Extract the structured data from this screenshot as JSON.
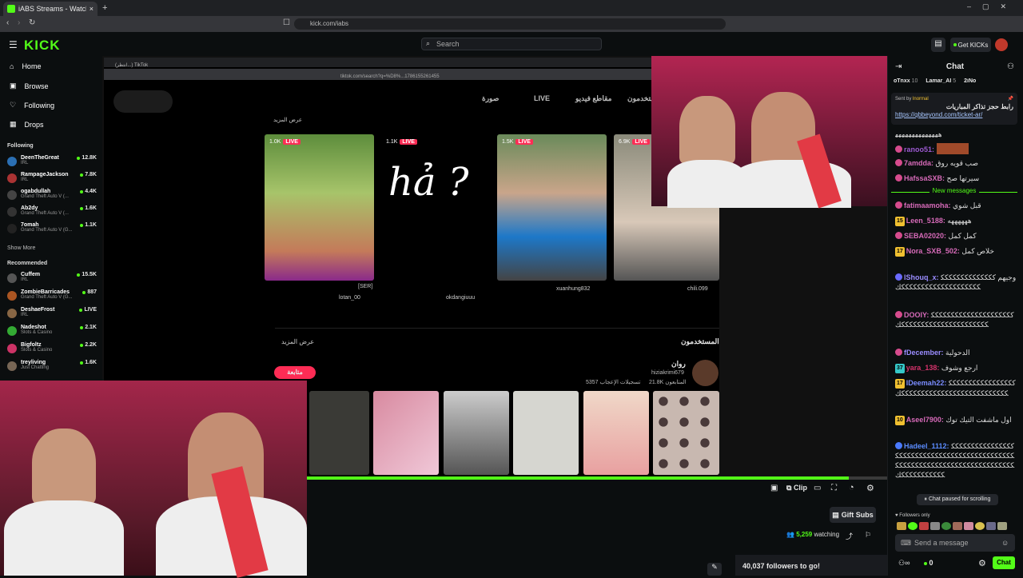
{
  "browser": {
    "tab_title": "iABS Streams - Watch Live on Kick",
    "url": "kick.com/iabs"
  },
  "header": {
    "logo": "KICK",
    "search_placeholder": "Search",
    "get_kicks": "Get KICKs"
  },
  "sidebar": {
    "nav": [
      {
        "label": "Home",
        "icon": "home-icon"
      },
      {
        "label": "Browse",
        "icon": "browse-icon"
      },
      {
        "label": "Following",
        "icon": "heart-icon"
      },
      {
        "label": "Drops",
        "icon": "drops-icon"
      }
    ],
    "following_title": "Following",
    "following": [
      {
        "name": "DeenTheGreat",
        "category": "IRL",
        "viewers": "12.8K"
      },
      {
        "name": "RampageJackson",
        "category": "IRL",
        "viewers": "7.8K"
      },
      {
        "name": "ogabdullah",
        "category": "Grand Theft Auto V (...",
        "viewers": "4.4K"
      },
      {
        "name": "Ab2dy",
        "category": "Grand Theft Auto V (...",
        "viewers": "1.6K"
      },
      {
        "name": "7omah",
        "category": "Grand Theft Auto V (G...",
        "viewers": "1.1K"
      }
    ],
    "show_more": "Show More",
    "recommended_title": "Recommended",
    "recommended": [
      {
        "name": "Cuffem",
        "category": "IRL",
        "viewers": "15.5K"
      },
      {
        "name": "ZombieBarricades",
        "category": "Grand Theft Auto V (G...",
        "viewers": "887"
      },
      {
        "name": "DeshaeFrost",
        "category": "IRL",
        "viewers": "LIVE"
      },
      {
        "name": "Nadeshot",
        "category": "Slots & Casino",
        "viewers": "2.1K"
      },
      {
        "name": "Bigfoltz",
        "category": "Slots & Casino",
        "viewers": "2.2K"
      },
      {
        "name": "treyliving",
        "category": "Just Chatting",
        "viewers": "1.6K"
      }
    ]
  },
  "stream_content": {
    "inner_tab": "(انتظر...) TikTok",
    "inner_url": "tiktok.com/search?q=%D8%...1786155261455",
    "tabs": [
      "صورة",
      "LIVE",
      "مقاطع فيديو",
      "مستخدمون"
    ],
    "more_label": "عرض المزيد",
    "cards": [
      {
        "viewers": "1.0K",
        "badge": "LIVE",
        "user": "lotan_00",
        "tag": "[SER]"
      },
      {
        "viewers": "1.1K",
        "badge": "LIVE",
        "user": "okdangiuuu",
        "handwriting": "hả ?"
      },
      {
        "viewers": "1.5K",
        "badge": "LIVE",
        "user": "xuanhung832"
      },
      {
        "viewers": "6.9K",
        "badge": "LIVE",
        "user": "chili.099"
      }
    ],
    "users_title": "المستخدمون",
    "users_more": "عرض المزيد",
    "profile_name": "روان",
    "profile_handle": "hiziakrimi679",
    "profile_followers": "21.8K المتابعون",
    "profile_likes": "5357 تسجيلات الإعجاب",
    "follow_button": "متابعة"
  },
  "player": {
    "progress": 0.934,
    "clip_label": "Clip",
    "gift_subs": "Gift Subs",
    "watching_count": "5,259",
    "watching_label": "watching",
    "followers_goal": "40,037 followers to go!"
  },
  "chat": {
    "title": "Chat",
    "top_gifters": [
      {
        "name": "oTnxx",
        "count": "10"
      },
      {
        "name": "Lamar_AI",
        "count": "5"
      },
      {
        "name": "2iNo",
        "count": ""
      }
    ],
    "pinned": {
      "sent_by": "Sent by",
      "sender": "lnormal",
      "text": "رابط حجز تذاكر المباريات",
      "link": "https://qbbeyond.com/ticket-ar/"
    },
    "messages_before": [
      {
        "user": "ranoo51:",
        "text": "",
        "color": "#9b59d0"
      },
      {
        "user": "7amdda:",
        "text": "صب قويه روق",
        "color": "#d66ab8"
      },
      {
        "user": "HafssaSXB:",
        "text": "سيرتها صح",
        "color": "#d66ab8"
      }
    ],
    "new_messages": "New messages",
    "messages": [
      {
        "user": "fatimaamoha:",
        "text": "قبل شوي",
        "color": "#d66ab8",
        "sub": ""
      },
      {
        "user": "Leen_5188:",
        "text": "ههههههه",
        "color": "#d66ab8",
        "sub": "15"
      },
      {
        "user": "SEBA02020:",
        "text": "كمل كمل",
        "color": "#d66ab8",
        "sub": ""
      },
      {
        "user": "Nora_SXB_502:",
        "text": "خلاص كمل",
        "color": "#d66ab8",
        "sub": "17"
      },
      {
        "user": "lShouq_x:",
        "text": "وجيهم ككككككككككككككككككككككككككككككككككك",
        "color": "#9a8cff",
        "sub": ""
      },
      {
        "user": "DOOIY:",
        "text": "كككككككككككككككككككككككككككككككككككككككككككك",
        "color": "#d66ab8",
        "sub": ""
      },
      {
        "user": "fDecember:",
        "text": "الدحولية",
        "color": "#9a8cff",
        "sub": ""
      },
      {
        "user": "yara_138:",
        "text": "ارجع وشوف",
        "color": "#d6336c",
        "sub": "37"
      },
      {
        "user": "lDeemah22:",
        "text": "ككككككككككككككككككككككككككككككككككككككككككككك",
        "color": "#7a8cff",
        "sub": "17"
      },
      {
        "user": "Aseel7900:",
        "text": "اول ماشفت التيك توك",
        "color": "#d66ab8",
        "sub": "10"
      },
      {
        "user": "Hadeel_1112:",
        "text": "كككككككككككككككككككككككككككككككككككككككككككككككككككككككككككككككككككككككككككككككككككككككك",
        "color": "#5b8cff",
        "sub": ""
      }
    ],
    "paused": "Chat paused for scrolling",
    "followers_only": "Followers only",
    "send_placeholder": "Send a message",
    "kicks_count": "0",
    "chat_button": "Chat"
  },
  "colors": {
    "accent": "#53fc18",
    "live": "#fe2c55",
    "bg": "#0b0e0f"
  }
}
